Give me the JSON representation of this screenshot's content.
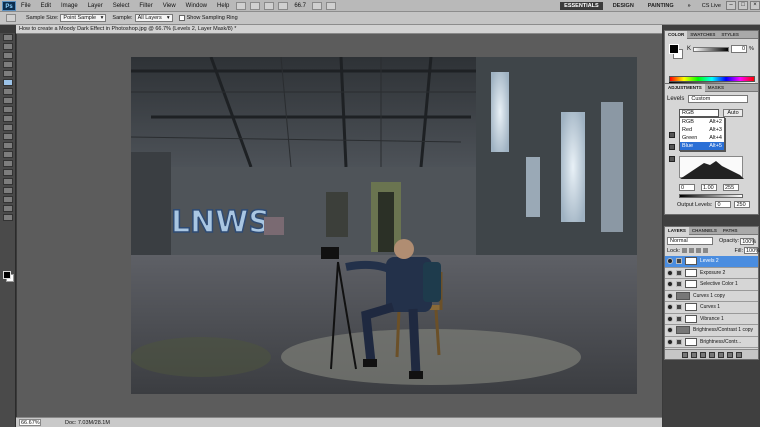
{
  "menu": {
    "logo": "Ps",
    "items": [
      "File",
      "Edit",
      "Image",
      "Layer",
      "Select",
      "Filter",
      "View",
      "Window",
      "Help"
    ],
    "zoom": "66.7",
    "workspaces": [
      "ESSENTIALS",
      "DESIGN",
      "PAINTING"
    ],
    "cs_live": "CS Live"
  },
  "options": {
    "sample_size_label": "Sample Size:",
    "sample_size_value": "Point Sample",
    "sample_label": "Sample:",
    "sample_value": "All Layers",
    "show_ring_label": "Show Sampling Ring"
  },
  "document": {
    "tab_title": "How to create a Moody Dark Effect in Photoshop.jpg @ 66.7% (Levels 2, Layer Mask/8) *",
    "status_zoom": "66.67%",
    "status_doc": "Doc: 7.03M/28.1M"
  },
  "color_panel": {
    "tabs": [
      "COLOR",
      "SWATCHES",
      "STYLES"
    ],
    "k_label": "K",
    "k_value": "0",
    "k_unit": "%"
  },
  "adjustments": {
    "tabs": [
      "ADJUSTMENTS",
      "MASKS"
    ],
    "levels_label": "Levels",
    "preset": "Custom",
    "channel": "RGB",
    "auto_label": "Auto",
    "channel_options": [
      {
        "name": "RGB",
        "shortcut": "Alt+2"
      },
      {
        "name": "Red",
        "shortcut": "Alt+3"
      },
      {
        "name": "Green",
        "shortcut": "Alt+4"
      },
      {
        "name": "Blue",
        "shortcut": "Alt+5"
      }
    ],
    "input_values": [
      "0",
      "1.00",
      "255"
    ],
    "output_label": "Output Levels:",
    "output_values": [
      "0",
      "250"
    ]
  },
  "layers": {
    "tabs": [
      "LAYERS",
      "CHANNELS",
      "PATHS"
    ],
    "blend_mode": "Normal",
    "opacity_label": "Opacity:",
    "opacity": "100%",
    "lock_label": "Lock:",
    "fill_label": "Fill:",
    "fill": "100%",
    "items": [
      {
        "name": "Levels 2",
        "selected": true,
        "kind": "adj"
      },
      {
        "name": "Exposure 2",
        "selected": false,
        "kind": "adj"
      },
      {
        "name": "Selective Color 1",
        "selected": false,
        "kind": "adj"
      },
      {
        "name": "Curves 1 copy",
        "selected": false,
        "kind": "img"
      },
      {
        "name": "Curves 1",
        "selected": false,
        "kind": "adj"
      },
      {
        "name": "Vibrance 1",
        "selected": false,
        "kind": "adj"
      },
      {
        "name": "Brightness/Contrast 1 copy",
        "selected": false,
        "kind": "img"
      },
      {
        "name": "Brightness/Contr...",
        "selected": false,
        "kind": "adj"
      }
    ]
  },
  "colors": {
    "selection_blue": "#2a6fd6",
    "layer_selected": "#4a8de0"
  }
}
